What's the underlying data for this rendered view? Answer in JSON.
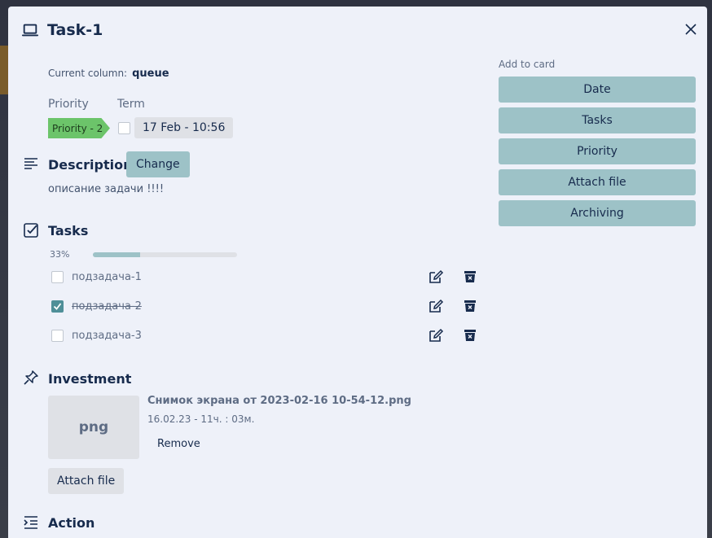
{
  "modal": {
    "title": "Task-1",
    "current_column_label": "Current column:",
    "current_column_value": "queue",
    "priority_label": "Priority",
    "priority_badge": "Priority - 2",
    "term_label": "Term",
    "term_date": "17 Feb - 10:56",
    "term_checked": false
  },
  "description": {
    "title": "Description",
    "change_label": "Change",
    "text": "описание задачи !!!!"
  },
  "tasks": {
    "title": "Tasks",
    "percent_label": "33%",
    "progress": 0.33,
    "items": [
      {
        "label": "подзадача-1",
        "checked": false
      },
      {
        "label": "подзадача-2",
        "checked": true
      },
      {
        "label": "подзадача-3",
        "checked": false
      }
    ]
  },
  "investment": {
    "title": "Investment",
    "file_type": "png",
    "file_name": "Снимок экрана от 2023-02-16 10-54-12.png",
    "file_date": "16.02.23 - 11ч. : 03м.",
    "remove_label": "Remove",
    "attach_label": "Attach file"
  },
  "action": {
    "title": "Action"
  },
  "sidebar": {
    "title": "Add to card",
    "buttons": [
      "Date",
      "Tasks",
      "Priority",
      "Attach file",
      "Archiving"
    ]
  },
  "colors": {
    "modal_bg": "#eef1f9",
    "accent": "#9dc2c7",
    "priority_green": "#6cc46a",
    "checkbox_checked": "#4f8f98"
  }
}
